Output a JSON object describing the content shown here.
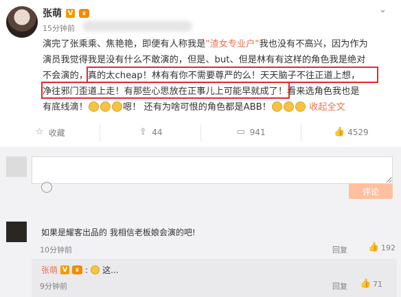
{
  "post": {
    "author": "张萌",
    "time": "15分钟前",
    "v_badge": "V",
    "crown_badge": "♛",
    "line1_a": "演完了张乘乘、焦艳艳，即便有人称我是",
    "line1_hl": "\"渣女专业户\"",
    "line1_b": "我也没有不高兴，因为作为",
    "line2": "演员我觉得我是没有什么不敢演的，但是、but、但是林有有这样的角色我是绝对",
    "line3": "不会演的，真的太cheap！林有有你不需要尊严的么！天天脑子不往正道上想，",
    "line4": "净往邪门歪道上走！有那些心思放在正事儿上可能早就成了！看来选角色我也是",
    "line5_a": "有底线滴！",
    "line5_b": "嗯！ 还有为啥可恨的角色都是ABB！",
    "collapse": "收起全文"
  },
  "actions": {
    "favorite": "收藏",
    "repost_count": "44",
    "comment_count": "941",
    "like_count": "4529"
  },
  "comment_box": {
    "placeholder": "",
    "submit": "评论"
  },
  "comments": [
    {
      "text": "如果是耀客出品的 我相信老板娘会演的吧!",
      "time": "10分钟前",
      "reply_label": "回复",
      "likes": "192"
    }
  ],
  "reply": {
    "author": "张萌",
    "text": "这...",
    "time": "9分钟前",
    "reply_label": "回复",
    "likes": "71"
  },
  "colors": {
    "accent": "#eb7350",
    "highlight_box": "#e5262b",
    "submit_bg": "#ffc09f"
  }
}
